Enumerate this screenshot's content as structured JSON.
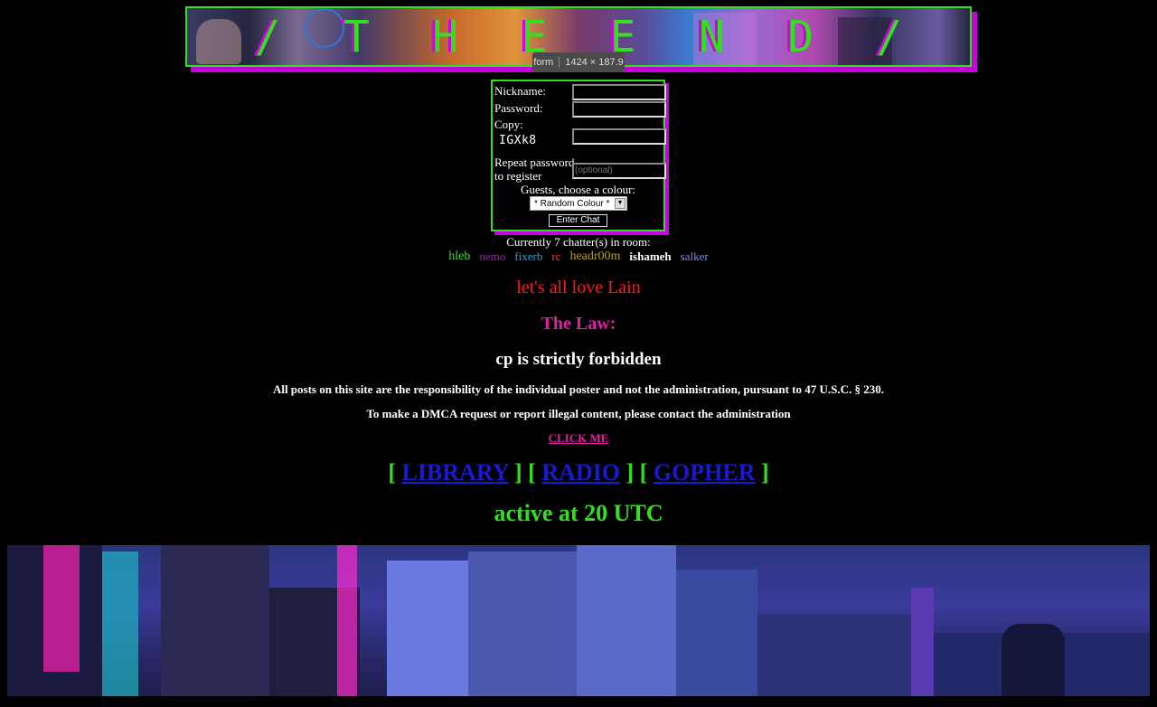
{
  "banner": {
    "letters": [
      "/",
      "T",
      "H",
      "E",
      "E",
      "N",
      "D",
      "/"
    ],
    "tooltip_tag": "form",
    "tooltip_size": "1424 × 187.9"
  },
  "login": {
    "nickname_label": "Nickname:",
    "password_label": "Password:",
    "copy_label": "Copy:",
    "captcha": "IGXk8",
    "repeat_label_line1": "Repeat password",
    "repeat_label_line2": "to register",
    "repeat_placeholder": "(optional)",
    "colour_label": "Guests, choose a colour:",
    "colour_selected": "* Random Colour *",
    "enter_label": "Enter Chat"
  },
  "chatters": {
    "count_text": "Currently 7 chatter(s) in room:",
    "users": [
      {
        "name": "hleb",
        "color": "#33e01f"
      },
      {
        "name": "nemo",
        "color": "#9c1fb8"
      },
      {
        "name": "fixerb",
        "color": "#2aa3e0"
      },
      {
        "name": "rc",
        "color": "#ff3a2a"
      },
      {
        "name": "headr00m",
        "color": "#b3a21f"
      },
      {
        "name": "ishameh",
        "color": "#ffffff"
      },
      {
        "name": "salker",
        "color": "#8a8ae0"
      }
    ]
  },
  "content": {
    "motd": "let's all love Lain",
    "law_title": "The Law:",
    "law_rule": "cp is strictly forbidden",
    "disclaimer": "All posts on this site are the responsibility of the individual poster and not the administration, pursuant to 47 U.S.C. § 230.",
    "dmca": "To make a DMCA request or report illegal content, please contact the administration",
    "click_me": "CLICK ME",
    "links": [
      "LIBRARY",
      "RADIO",
      "GOPHER"
    ],
    "active": "active at 20 UTC"
  },
  "colors": {
    "accent_green": "#33e01f",
    "accent_magenta": "#c800e0",
    "law_pink": "#e01fa3",
    "link_blue": "#1a1acc"
  }
}
